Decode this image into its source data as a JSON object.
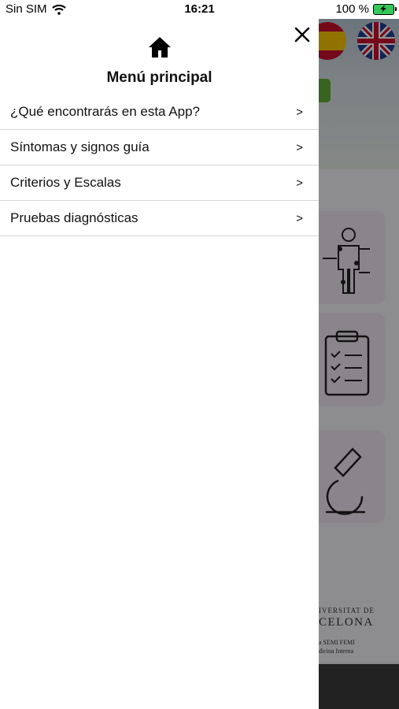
{
  "status_bar": {
    "carrier": "Sin SIM",
    "time": "16:21",
    "battery_percent": "100 %"
  },
  "drawer": {
    "title": "Menú principal",
    "items": [
      {
        "label": "¿Qué encontrarás en esta App?",
        "chevron": ">"
      },
      {
        "label": "Síntomas y signos guía",
        "chevron": ">"
      },
      {
        "label": "Criterios y Escalas",
        "chevron": ">"
      },
      {
        "label": "Pruebas diagnósticas",
        "chevron": ">"
      }
    ]
  },
  "background": {
    "footer_line1": "IVERSITAT DE",
    "footer_line2": "CELONA",
    "footer_line3": "a SEMI FEMI",
    "footer_line4": "dicina Interna"
  },
  "colors": {
    "battery": "#34c759",
    "scrim": "rgba(0,0,0,0.42)"
  }
}
